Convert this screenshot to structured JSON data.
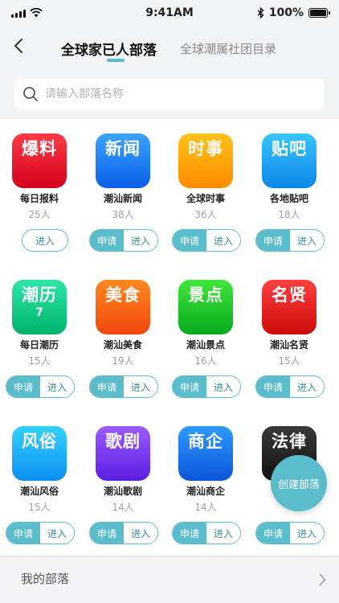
{
  "status_bar": {
    "time": "9:41AM",
    "battery": "100%",
    "battery_level": 1.0
  },
  "header": {
    "tab_active": "全球家已人部落",
    "tab_other": "全球潮属社团目录"
  },
  "search": {
    "placeholder": "请输入部落名称"
  },
  "buttons": {
    "apply": "申请",
    "enter": "进入"
  },
  "tribes": [
    {
      "icon_text": "爆料",
      "name": "每日报料",
      "count": "25人",
      "color_top": "#ff3b47",
      "color_bottom": "#d4001a",
      "joined": true
    },
    {
      "icon_text": "新闻",
      "name": "潮汕新闻",
      "count": "38人",
      "color_top": "#3aa4ff",
      "color_bottom": "#0a5fe8",
      "joined": false
    },
    {
      "icon_text": "时事",
      "name": "全球时事",
      "count": "36人",
      "color_top": "#ffc21a",
      "color_bottom": "#ff8c00",
      "joined": false
    },
    {
      "icon_text": "贴吧",
      "name": "各地贴吧",
      "count": "18人",
      "color_top": "#39c6ff",
      "color_bottom": "#0d86e6",
      "joined": false
    },
    {
      "icon_text": "潮历",
      "name": "每日潮历",
      "count": "15人",
      "sub": "7",
      "color_top": "#2ee6a8",
      "color_bottom": "#00b36b",
      "joined": false
    },
    {
      "icon_text": "美食",
      "name": "潮汕美食",
      "count": "19人",
      "color_top": "#ff8a1f",
      "color_bottom": "#f2460f",
      "joined": false
    },
    {
      "icon_text": "景点",
      "name": "潮汕景点",
      "count": "16人",
      "color_top": "#43e63a",
      "color_bottom": "#05a81e",
      "joined": false
    },
    {
      "icon_text": "名贤",
      "name": "潮汕名贤",
      "count": "15人",
      "color_top": "#ff4040",
      "color_bottom": "#cc0a0a",
      "joined": false
    },
    {
      "icon_text": "风俗",
      "name": "潮汕风俗",
      "count": "15人",
      "color_top": "#33d2ff",
      "color_bottom": "#0e8ff0",
      "joined": false
    },
    {
      "icon_text": "歌剧",
      "name": "潮汕歌剧",
      "count": "14人",
      "color_top": "#9a5cff",
      "color_bottom": "#5a1fe0",
      "joined": false
    },
    {
      "icon_text": "商企",
      "name": "潮汕商企",
      "count": "14人",
      "color_top": "#2f9bff",
      "color_bottom": "#0a55d9",
      "joined": false
    },
    {
      "icon_text": "法律",
      "name": "",
      "count": "",
      "color_top": "#3a3a3a",
      "color_bottom": "#111111",
      "joined": false
    }
  ],
  "fab": {
    "label": "创建部落"
  },
  "bottom": {
    "label": "我的部落"
  }
}
